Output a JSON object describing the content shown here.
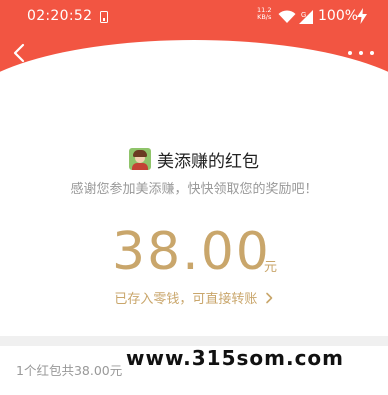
{
  "status_bar": {
    "time": "02:20:52",
    "net_speed_value": "11.2",
    "net_speed_unit": "KB/s",
    "battery": "100%"
  },
  "header": {
    "color": "#f25542",
    "back_icon": "chevron-left-icon",
    "more_icon": "more-dots-icon"
  },
  "packet": {
    "title": "美添赚的红包",
    "greeting": "感谢您参加美添赚，快快领取您的奖励吧！",
    "amount": "38.00",
    "unit": "元",
    "wallet_link": "已存入零钱，可直接转账",
    "accent_color": "#c9a66b"
  },
  "summary": {
    "text": "1个红包共38.00元"
  },
  "watermark": {
    "text": "www.315som.com"
  }
}
